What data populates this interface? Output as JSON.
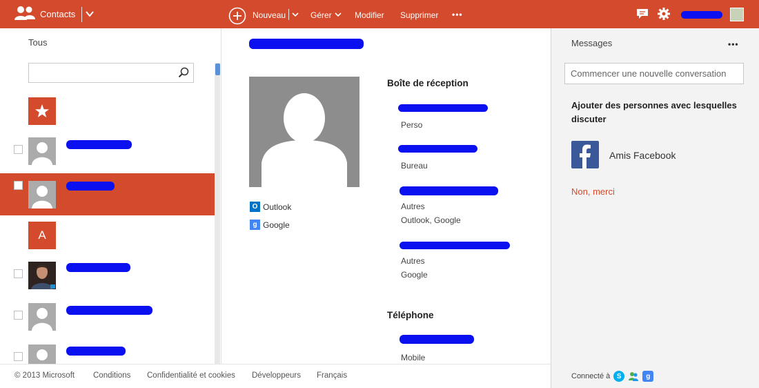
{
  "topbar": {
    "app_name": "Contacts",
    "icons": {
      "app": "people-icon",
      "menu": "chevron-down-icon",
      "new": "plus-circle-icon",
      "chat": "chat-icon",
      "settings": "gear-icon",
      "more": "ellipsis-icon"
    },
    "new_label": "Nouveau",
    "manage_label": "Gérer",
    "edit_label": "Modifier",
    "delete_label": "Supprimer",
    "more_label": "•••",
    "accent": "#d34a2c"
  },
  "left": {
    "filter_label": "Tous",
    "search": {
      "value": "",
      "placeholder": ""
    },
    "letter_group": "A",
    "icons": {
      "favorites": "star-icon",
      "search": "search-icon"
    }
  },
  "contact": {
    "sources": [
      {
        "icon": "outlook-icon",
        "label": "Outlook"
      },
      {
        "icon": "google-icon",
        "label": "Google"
      }
    ],
    "inbox_title": "Boîte de réception",
    "emails": [
      {
        "type": "Perso",
        "sources": ""
      },
      {
        "type": "Bureau",
        "sources": ""
      },
      {
        "type": "Autres",
        "sources": "Outlook, Google"
      },
      {
        "type": "Autres",
        "sources": "Google"
      }
    ],
    "phone_title": "Téléphone",
    "phones": [
      {
        "type": "Mobile"
      }
    ]
  },
  "messages": {
    "title": "Messages",
    "more_label": "•••",
    "new_conversation_placeholder": "Commencer une nouvelle conversation",
    "add_people_text": "Ajouter des personnes avec lesquelles discuter",
    "facebook_label": "Amis Facebook",
    "no_thanks": "Non, merci",
    "connected_label": "Connecté à",
    "services": [
      "skype-icon",
      "messenger-icon",
      "google-icon"
    ]
  },
  "footer": {
    "copyright": "© 2013 Microsoft",
    "terms": "Conditions",
    "privacy": "Confidentialité et cookies",
    "developers": "Développeurs",
    "language": "Français"
  },
  "colors": {
    "accent": "#d34a2c",
    "redaction": "#0a10f0",
    "facebook": "#3b5998",
    "outlook": "#0072c6",
    "google": "#4285f4"
  }
}
